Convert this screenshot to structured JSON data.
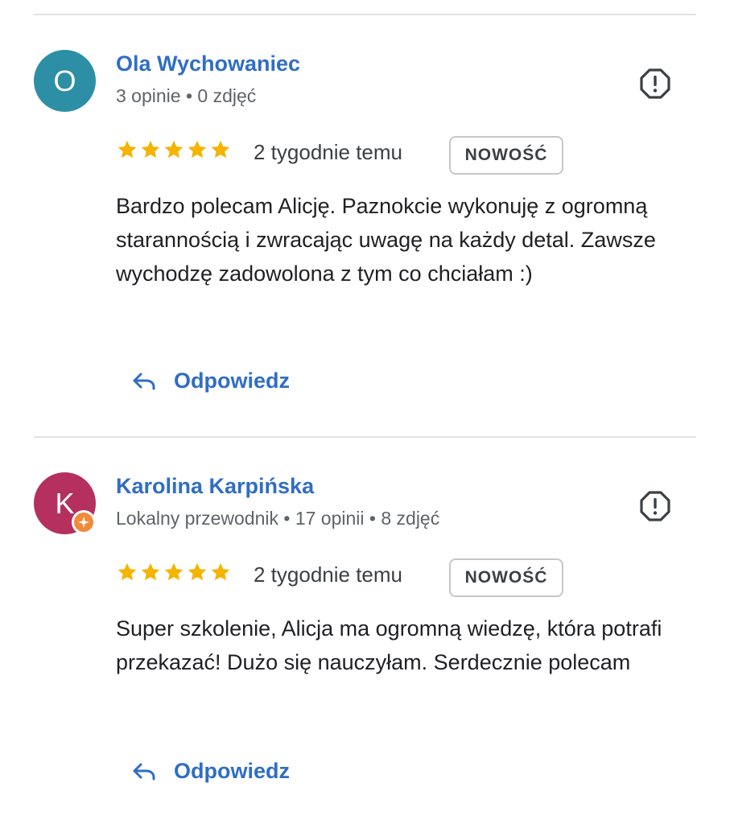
{
  "reviews": [
    {
      "avatar_initial": "O",
      "avatar_color": "#2d8fa6",
      "author": "Ola Wychowaniec",
      "meta": "3 opinie • 0 zdjęć",
      "local_guide": false,
      "rating": 5,
      "time": "2 tygodnie temu",
      "badge": "NOWOŚĆ",
      "text": "Bardzo polecam Alicję. Paznokcie wykonuję z ogromną starannością i zwracając uwagę na każdy detal. Zawsze wychodzę zadowolona z tym co chciałam :)",
      "reply_label": "Odpowiedz",
      "report_icon": "report-flag-icon"
    },
    {
      "avatar_initial": "K",
      "avatar_color": "#b5305e",
      "author": "Karolina Karpińska",
      "meta": "Lokalny przewodnik • 17 opinii • 8 zdjęć",
      "local_guide": true,
      "rating": 5,
      "time": "2 tygodnie temu",
      "badge": "NOWOŚĆ",
      "text": "Super szkolenie, Alicja ma ogromną wiedzę, która potrafi przekazać! Dużo się nauczyłam. Serdecznie polecam",
      "reply_label": "Odpowiedz",
      "report_icon": "report-flag-icon"
    }
  ],
  "colors": {
    "link_blue": "#2f6ec4",
    "star_gold": "#f4b400",
    "local_guide_orange": "#f28a3a"
  }
}
